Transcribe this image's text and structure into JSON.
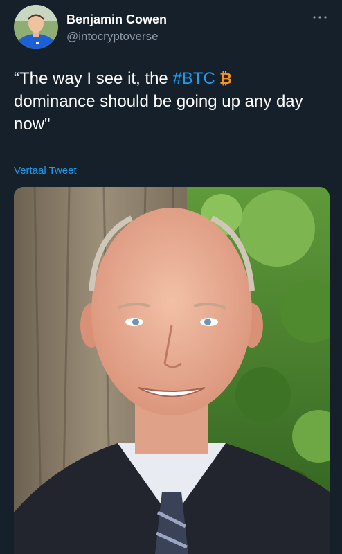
{
  "tweet": {
    "author": {
      "name": "Benjamin Cowen",
      "handle": "@intocryptoverse"
    },
    "more_icon": "more-horizontal-icon",
    "text": {
      "before_hashtag": "“The way I see it, the ",
      "hashtag": "#BTC",
      "emoji": "bitcoin-emoji",
      "after_hashtag": "dominance should be going up any day now\""
    },
    "translate_label": "Vertaal Tweet",
    "media": {
      "kind": "photo"
    }
  },
  "colors": {
    "background": "#15202b",
    "text": "#ffffff",
    "secondary_text": "#8b98a5",
    "accent": "#1d9bf0",
    "bitcoin": "#f7931a"
  }
}
